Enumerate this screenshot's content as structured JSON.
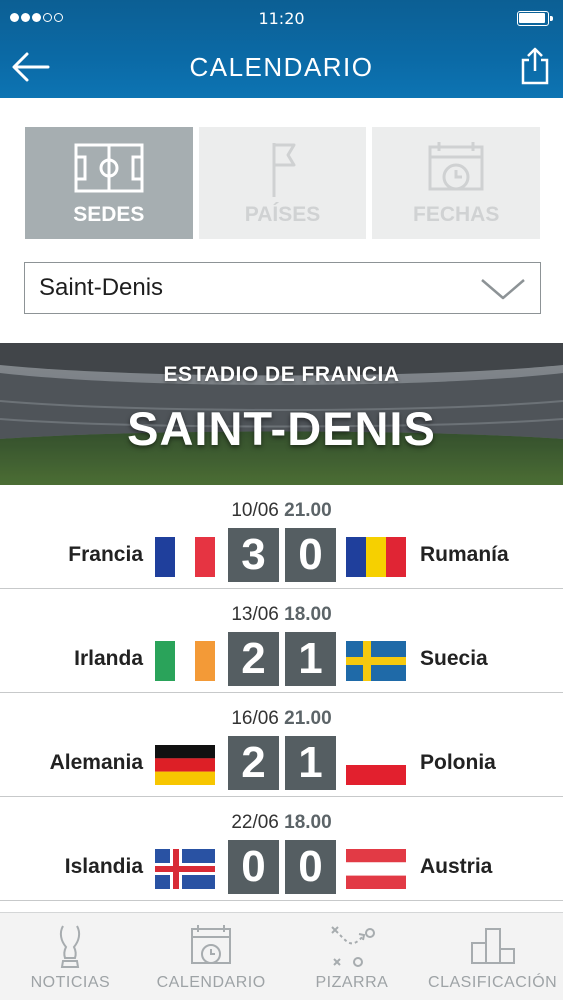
{
  "status_bar": {
    "time": "11:20"
  },
  "header": {
    "title": "CALENDARIO"
  },
  "segment": {
    "tabs": [
      {
        "label": "SEDES",
        "icon": "pitch-icon",
        "active": true
      },
      {
        "label": "PAÍSES",
        "icon": "flag-icon",
        "active": false
      },
      {
        "label": "FECHAS",
        "icon": "calendar-icon",
        "active": false
      }
    ]
  },
  "dropdown": {
    "value": "Saint-Denis"
  },
  "banner": {
    "subtitle": "ESTADIO DE FRANCIA",
    "title": "SAINT-DENIS"
  },
  "matches": [
    {
      "date": "10/06",
      "time": "21.00",
      "home": "Francia",
      "away": "Rumanía",
      "home_score": "3",
      "away_score": "0",
      "home_flag": [
        "#1f3f9c",
        "#ffffff",
        "#e63442"
      ],
      "away_flag": [
        "#1f3f9c",
        "#f6d000",
        "#e02534"
      ]
    },
    {
      "date": "13/06",
      "time": "18.00",
      "home": "Irlanda",
      "away": "Suecia",
      "home_score": "2",
      "away_score": "1",
      "home_flag": [
        "#2aa35a",
        "#ffffff",
        "#f39a37"
      ],
      "away_flag": [
        "#1f6aa8",
        "#f6c90e"
      ]
    },
    {
      "date": "16/06",
      "time": "21.00",
      "home": "Alemania",
      "away": "Polonia",
      "home_score": "2",
      "away_score": "1",
      "home_flag": [
        "#111111",
        "#dd1f26",
        "#f7c600"
      ],
      "away_flag": [
        "#ffffff",
        "#e2202e"
      ]
    },
    {
      "date": "22/06",
      "time": "18.00",
      "home": "Islandia",
      "away": "Austria",
      "home_score": "0",
      "away_score": "0",
      "home_flag": [
        "#2952a3",
        "#ffffff",
        "#d82b36"
      ],
      "away_flag": [
        "#e23a45",
        "#ffffff"
      ]
    }
  ],
  "tabbar": {
    "items": [
      {
        "label": "NOTICIAS",
        "icon": "trophy-icon"
      },
      {
        "label": "CALENDARIO",
        "icon": "calendar-icon"
      },
      {
        "label": "PIZARRA",
        "icon": "tactics-board-icon"
      },
      {
        "label": "CLASIFICACIÓN",
        "icon": "podium-icon"
      }
    ]
  }
}
